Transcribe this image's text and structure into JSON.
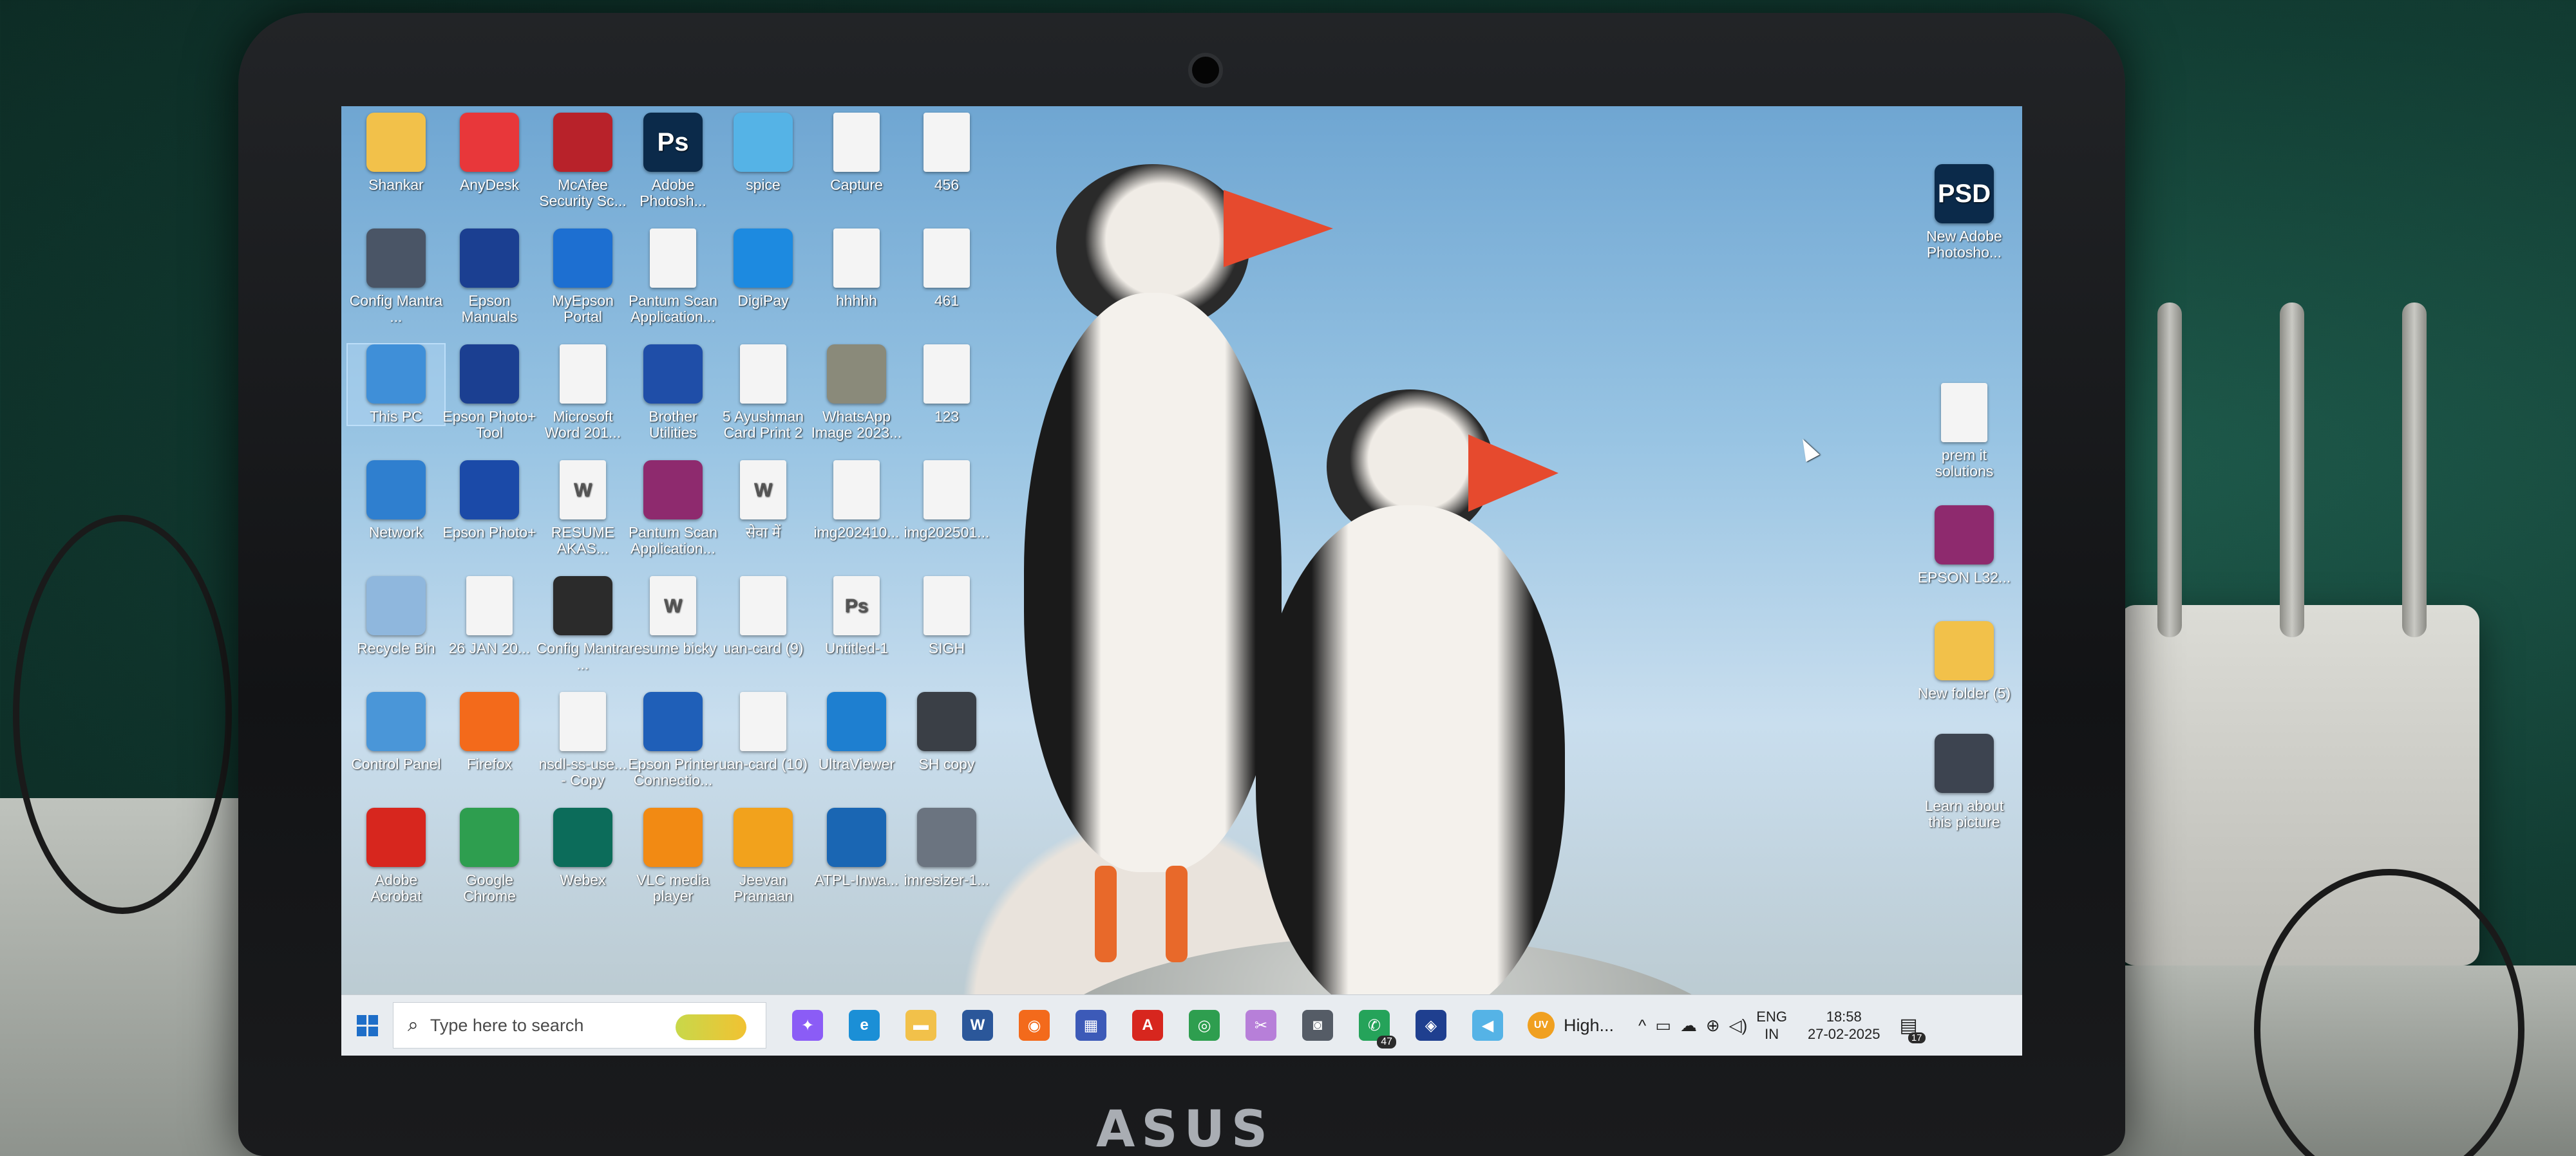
{
  "monitor": {
    "brand": "ASUS"
  },
  "desktop": {
    "icons_col1": [
      {
        "label": "Shankar",
        "glyph": "",
        "color": "#f2c14a",
        "icon": "folder-user-icon"
      },
      {
        "label": "Config Mantra ...",
        "glyph": "",
        "color": "#4a5566",
        "icon": "device-icon"
      },
      {
        "label": "This PC",
        "glyph": "",
        "color": "#3f8fd8",
        "icon": "monitor-icon",
        "selected": true
      },
      {
        "label": "Network",
        "glyph": "",
        "color": "#2f7fcf",
        "icon": "network-icon"
      },
      {
        "label": "Recycle Bin",
        "glyph": "",
        "color": "#8fb7dd",
        "icon": "recycle-bin-icon"
      },
      {
        "label": "Control Panel",
        "glyph": "",
        "color": "#4a96d8",
        "icon": "control-panel-icon"
      },
      {
        "label": "Adobe Acrobat",
        "glyph": "",
        "color": "#d7261e",
        "icon": "acrobat-icon"
      }
    ],
    "icons_col2": [
      {
        "label": "AnyDesk",
        "glyph": "",
        "color": "#e8373a",
        "icon": "anydesk-icon"
      },
      {
        "label": "Epson Manuals",
        "glyph": "",
        "color": "#1b3f91",
        "icon": "epson-manuals-icon"
      },
      {
        "label": "Epson Photo+ Tool",
        "glyph": "",
        "color": "#1b3f91",
        "icon": "epson-photo-tool-icon"
      },
      {
        "label": "Epson Photo+",
        "glyph": "",
        "color": "#1b4aa8",
        "icon": "epson-photo-icon"
      },
      {
        "label": "26 JAN 20...",
        "glyph": "",
        "color": "#f4f4f4",
        "icon": "pdf-document-icon",
        "doc": true
      },
      {
        "label": "Firefox",
        "glyph": "",
        "color": "#f36a1b",
        "icon": "firefox-icon"
      },
      {
        "label": "Google Chrome",
        "glyph": "",
        "color": "#2e9e4f",
        "icon": "chrome-icon"
      }
    ],
    "icons_col3": [
      {
        "label": "McAfee Security Sc...",
        "glyph": "",
        "color": "#b8222a",
        "icon": "mcafee-icon"
      },
      {
        "label": "MyEpson Portal",
        "glyph": "",
        "color": "#1d6fd1",
        "icon": "info-icon"
      },
      {
        "label": "Microsoft Word 201...",
        "glyph": "",
        "color": "#f4f4f4",
        "icon": "document-icon",
        "doc": true
      },
      {
        "label": "RESUME AKAS...",
        "glyph": "W",
        "color": "#f4f4f4",
        "icon": "word-document-icon",
        "doc": true
      },
      {
        "label": "Config Mantra ...",
        "glyph": "",
        "color": "#2b2b2b",
        "icon": "device-icon"
      },
      {
        "label": "nsdl-ss-use... - Copy",
        "glyph": "",
        "color": "#f4f4f4",
        "icon": "document-icon",
        "doc": true
      },
      {
        "label": "Webex",
        "glyph": "",
        "color": "#0c6c5a",
        "icon": "webex-icon"
      }
    ],
    "icons_col4": [
      {
        "label": "Adobe Photosh...",
        "glyph": "Ps",
        "color": "#0b2a4a",
        "icon": "photoshop-icon"
      },
      {
        "label": "Pantum Scan Application...",
        "glyph": "",
        "color": "#f4f4f4",
        "icon": "document-icon",
        "doc": true
      },
      {
        "label": "Brother Utilities",
        "glyph": "",
        "color": "#1f4ea8",
        "icon": "brother-utilities-icon"
      },
      {
        "label": "Pantum Scan Application...",
        "glyph": "",
        "color": "#8e2a6e",
        "icon": "winrar-icon"
      },
      {
        "label": "resume bicky",
        "glyph": "W",
        "color": "#f4f4f4",
        "icon": "word-document-icon",
        "doc": true
      },
      {
        "label": "Epson Printer Connectio...",
        "glyph": "",
        "color": "#1f5fb8",
        "icon": "epson-connect-icon"
      },
      {
        "label": "VLC media player",
        "glyph": "",
        "color": "#f28a13",
        "icon": "vlc-icon"
      }
    ],
    "icons_col5": [
      {
        "label": "spice",
        "glyph": "",
        "color": "#55b3e6",
        "icon": "flutter-icon"
      },
      {
        "label": "DigiPay",
        "glyph": "",
        "color": "#1d8ae0",
        "icon": "digipay-icon"
      },
      {
        "label": "5 Ayushman Card Print 2",
        "glyph": "",
        "color": "#f4f4f4",
        "icon": "actions-icon",
        "doc": true
      },
      {
        "label": "सेवा में",
        "glyph": "W",
        "color": "#f4f4f4",
        "icon": "word-document-icon",
        "doc": true
      },
      {
        "label": "uan-card (9)",
        "glyph": "",
        "color": "#f4f4f4",
        "icon": "pdf-document-icon",
        "doc": true
      },
      {
        "label": "uan-card (10)",
        "glyph": "",
        "color": "#f4f4f4",
        "icon": "pdf-document-icon",
        "doc": true
      },
      {
        "label": "Jeevan Pramaan",
        "glyph": "",
        "color": "#f2a21c",
        "icon": "jeevan-pramaan-icon"
      }
    ],
    "icons_col6": [
      {
        "label": "Capture",
        "glyph": "",
        "color": "#f4f4f4",
        "icon": "image-icon",
        "doc": true
      },
      {
        "label": "hhhhh",
        "glyph": "",
        "color": "#f4f4f4",
        "icon": "image-icon",
        "doc": true
      },
      {
        "label": "WhatsApp Image 2023...",
        "glyph": "",
        "color": "#8a8a7a",
        "icon": "image-icon"
      },
      {
        "label": "img202410...",
        "glyph": "",
        "color": "#f4f4f4",
        "icon": "image-icon",
        "doc": true
      },
      {
        "label": "Untitled-1",
        "glyph": "Ps",
        "color": "#f4f4f4",
        "icon": "psd-file-icon",
        "doc": true
      },
      {
        "label": "UltraViewer",
        "glyph": "",
        "color": "#1e7fd0",
        "icon": "ultraviewer-icon"
      },
      {
        "label": "ATPL-Inwa...",
        "glyph": "",
        "color": "#1a66b3",
        "icon": "atpl-icon"
      }
    ],
    "icons_col7": [
      {
        "label": "456",
        "glyph": "",
        "color": "#f4f4f4",
        "icon": "image-icon",
        "doc": true
      },
      {
        "label": "461",
        "glyph": "",
        "color": "#f4f4f4",
        "icon": "image-icon",
        "doc": true
      },
      {
        "label": "123",
        "glyph": "",
        "color": "#f4f4f4",
        "icon": "image-icon",
        "doc": true
      },
      {
        "label": "img202501...",
        "glyph": "",
        "color": "#f4f4f4",
        "icon": "pdf-document-icon",
        "doc": true
      },
      {
        "label": "SIGH",
        "glyph": "",
        "color": "#f4f4f4",
        "icon": "image-icon",
        "doc": true
      },
      {
        "label": "SH copy",
        "glyph": "",
        "color": "#3a3f46",
        "icon": "photo-person-icon"
      },
      {
        "label": "imresizer-1...",
        "glyph": "",
        "color": "#6b7480",
        "icon": "photo-person-icon"
      }
    ],
    "icons_right": [
      {
        "label": "New Adobe Photosho...",
        "glyph": "PSD",
        "color": "#0b2a4a",
        "icon": "psd-file-icon"
      },
      {
        "label": "prem it solutions",
        "glyph": "",
        "color": "#f4f4f4",
        "icon": "qr-document-icon",
        "doc": true
      },
      {
        "label": "EPSON L32...",
        "glyph": "",
        "color": "#8e2a6e",
        "icon": "winrar-icon"
      },
      {
        "label": "New folder (5)",
        "glyph": "",
        "color": "#f2c14a",
        "icon": "folder-icon"
      },
      {
        "label": "Learn about this picture",
        "glyph": "",
        "color": "#3d4450",
        "icon": "camera-info-icon"
      }
    ]
  },
  "taskbar": {
    "search_placeholder": "Type here to search",
    "apps": [
      {
        "name": "copilot",
        "glyph": "✦",
        "color": "#8b5cf6"
      },
      {
        "name": "edge",
        "glyph": "e",
        "color": "#1b8fd6"
      },
      {
        "name": "file-explorer",
        "glyph": "▬",
        "color": "#f2c14a"
      },
      {
        "name": "word",
        "glyph": "W",
        "color": "#2b579a"
      },
      {
        "name": "firefox",
        "glyph": "◉",
        "color": "#f36a1b"
      },
      {
        "name": "store",
        "glyph": "▦",
        "color": "#3c5ab8"
      },
      {
        "name": "acrobat",
        "glyph": "A",
        "color": "#d7261e"
      },
      {
        "name": "chrome",
        "glyph": "◎",
        "color": "#2e9e4f"
      },
      {
        "name": "snipping",
        "glyph": "✂",
        "color": "#b77fd9"
      },
      {
        "name": "camera",
        "glyph": "◙",
        "color": "#555c66"
      },
      {
        "name": "whatsapp",
        "glyph": "✆",
        "color": "#25a35a",
        "badge": "47"
      },
      {
        "name": "epson",
        "glyph": "◈",
        "color": "#1f3f8f"
      },
      {
        "name": "flutter",
        "glyph": "◀",
        "color": "#55b3e6"
      }
    ],
    "weather": {
      "badge": "UV",
      "text": "High..."
    },
    "tray": {
      "chevron": "^",
      "lang_line1": "ENG",
      "lang_line2": "IN",
      "time": "18:58",
      "date": "27-02-2025",
      "notification_count": "17"
    }
  }
}
